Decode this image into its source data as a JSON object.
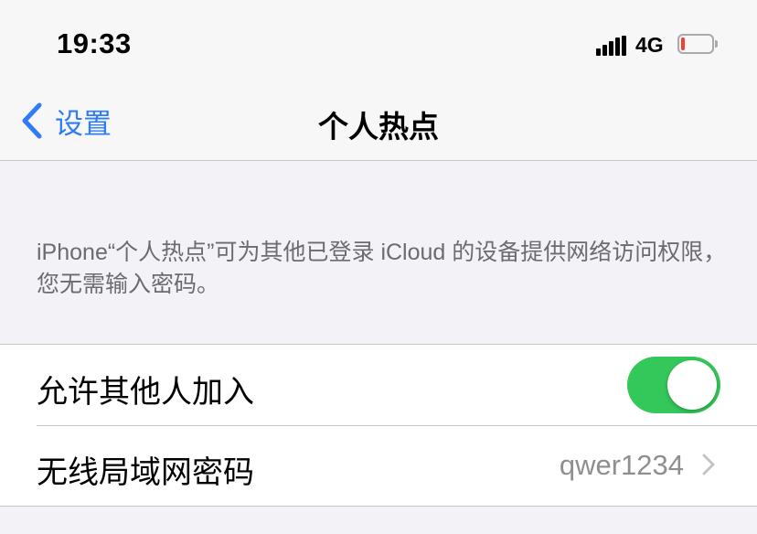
{
  "status_bar": {
    "time": "19:33",
    "network": "4G",
    "battery_level": 0.1,
    "battery_color": "#ff3b30"
  },
  "nav": {
    "back_label": "设置",
    "title": "个人热点",
    "accent_color": "#2f7cf6"
  },
  "description": "iPhone“个人热点”可为其他已登录 iCloud 的设备提供网络访问权限，您无需输入密码。",
  "settings": {
    "allow_others": {
      "label": "允许其他人加入",
      "enabled": true,
      "toggle_color": "#34c759"
    },
    "wifi_password": {
      "label": "无线局域网密码",
      "value": "qwer1234"
    }
  }
}
